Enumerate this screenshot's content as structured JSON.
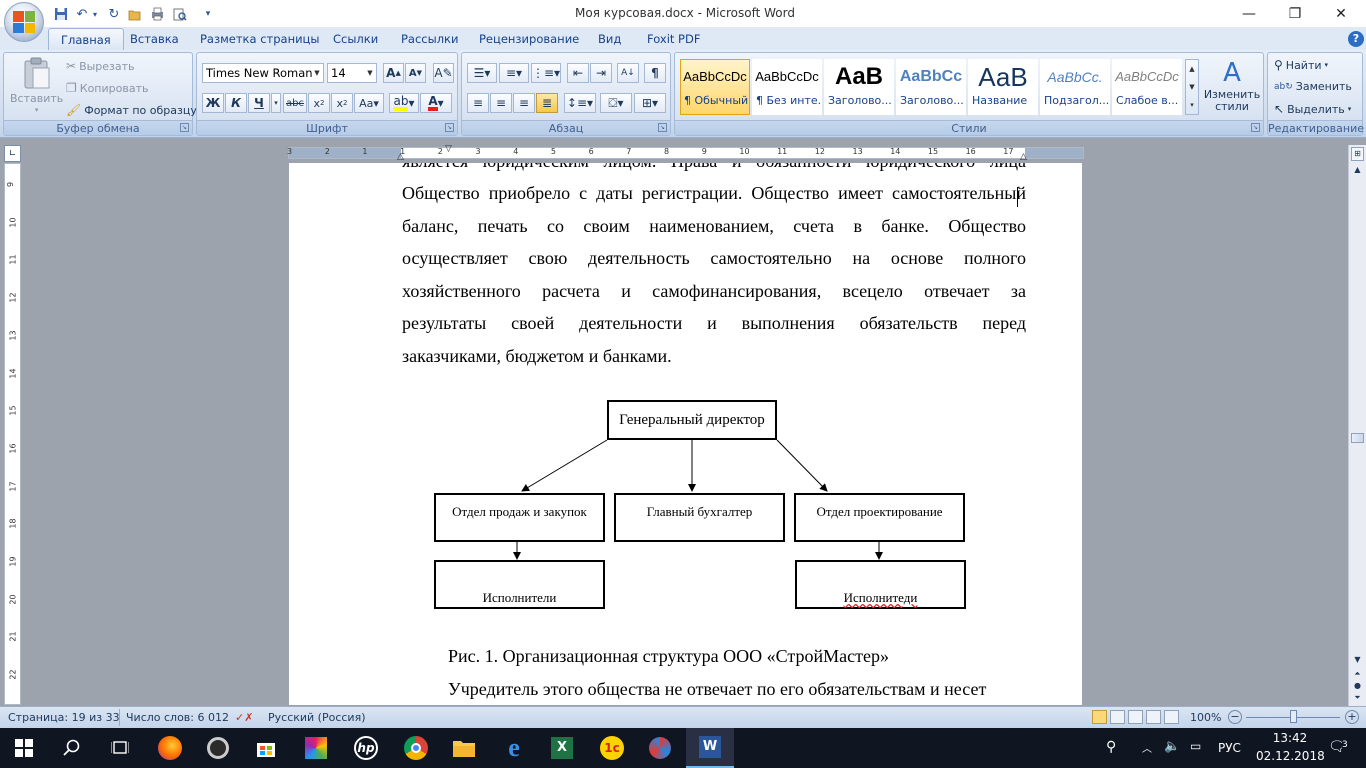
{
  "window": {
    "title": "Моя курсовая.docx - Microsoft Word",
    "minimize": "—",
    "restore": "❐",
    "close": "✕"
  },
  "tabs": [
    "Главная",
    "Вставка",
    "Разметка страницы",
    "Ссылки",
    "Рассылки",
    "Рецензирование",
    "Вид",
    "Foxit PDF"
  ],
  "ribbon": {
    "clipboard": {
      "label": "Буфер обмена",
      "paste": "Вставить",
      "cut": "Вырезать",
      "copy": "Копировать",
      "format_painter": "Формат по образцу"
    },
    "font": {
      "label": "Шрифт",
      "family": "Times New Roman",
      "size": "14"
    },
    "paragraph": {
      "label": "Абзац"
    },
    "styles": {
      "label": "Стили",
      "items": [
        {
          "sample": "AaBbCcDc",
          "name": "¶ Обычный"
        },
        {
          "sample": "AaBbCcDc",
          "name": "¶ Без инте..."
        },
        {
          "sample": "AaB",
          "name": "Заголово..."
        },
        {
          "sample": "AaBbCc",
          "name": "Заголово..."
        },
        {
          "sample": "АаВ",
          "name": "Название"
        },
        {
          "sample": "AaBbCc.",
          "name": "Подзагол..."
        },
        {
          "sample": "AaBbCcDc",
          "name": "Слабое в..."
        }
      ],
      "change": "Изменить стили"
    },
    "editing": {
      "label": "Редактирование",
      "find": "Найти",
      "replace": "Заменить",
      "select": "Выделить"
    }
  },
  "ruler": {
    "h_ticks": [
      "3",
      "2",
      "1",
      "1",
      "2",
      "3",
      "4",
      "5",
      "6",
      "7",
      "8",
      "9",
      "10",
      "11",
      "12",
      "13",
      "14",
      "15",
      "16",
      "17"
    ],
    "v_ticks": [
      "9",
      "10",
      "11",
      "12",
      "13",
      "14",
      "15",
      "16",
      "17",
      "18",
      "19",
      "20",
      "21",
      "22"
    ]
  },
  "document": {
    "lines": [
      "является юридическим лицом. Права и обязанности юридического лица",
      "Общество приобрело с даты регистрации. Общество имеет самостоятельный",
      "баланс, печать со своим наименованием, счета в банке. Общество",
      "осуществляет свою деятельность самостоятельно на основе полного",
      "хозяйственного расчета и самофинансирования, всецело отвечает за",
      "результаты своей деятельности и выполнения обязательств перед",
      "заказчиками, бюджетом и банками."
    ],
    "org_chart": {
      "root": "Генеральный директор",
      "level1": [
        "Отдел продаж и закупок",
        "Главный бухгалтер",
        "Отдел проектирование"
      ],
      "level2_left": "Исполнители",
      "level2_right": "Исполнитеди"
    },
    "caption": "Рис. 1. Организационная структура ООО «СтройМастер»",
    "next_line": "Учредитель  этого общества не отвечает по его обязательствам и несет"
  },
  "status": {
    "page": "Страница: 19 из 33",
    "words": "Число слов: 6 012",
    "language": "Русский (Россия)",
    "zoom": "100%"
  },
  "taskbar": {
    "lang": "РУС",
    "time": "13:42",
    "date": "02.12.2018",
    "notifications": "3"
  },
  "colors": {
    "ribbon_bg": "#cfdcee",
    "accent": "#15428b",
    "taskbar": "#101522"
  }
}
